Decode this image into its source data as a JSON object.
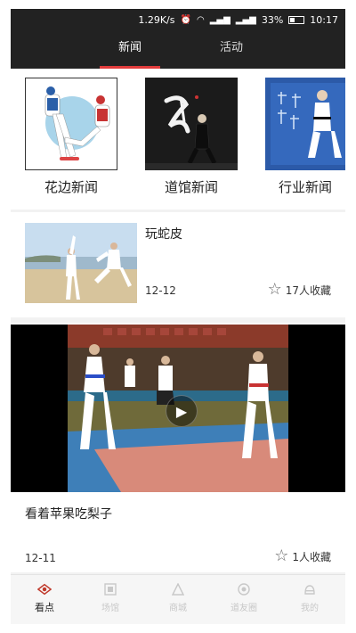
{
  "status_bar": {
    "speed": "1.29K/s",
    "battery": "33%",
    "time": "10:17"
  },
  "tabs": [
    {
      "label": "新闻",
      "active": true
    },
    {
      "label": "活动",
      "active": false
    }
  ],
  "categories": [
    {
      "label": "花边新闻"
    },
    {
      "label": "道馆新闻"
    },
    {
      "label": "行业新闻"
    }
  ],
  "articles": [
    {
      "title": "玩蛇皮",
      "date": "12-12",
      "favorites": "17人收藏",
      "star_icon": "star-outline-icon"
    },
    {
      "title": "看着苹果吃梨子",
      "date": "12-11",
      "favorites": "1人收藏",
      "star_icon": "star-outline-icon",
      "has_video": true
    }
  ],
  "bottom_nav": [
    {
      "label": "看点",
      "icon": "eye-icon",
      "active": true
    },
    {
      "label": "场馆",
      "icon": "venue-icon",
      "active": false
    },
    {
      "label": "商城",
      "icon": "mall-icon",
      "active": false
    },
    {
      "label": "道友圈",
      "icon": "circle-icon",
      "active": false
    },
    {
      "label": "我的",
      "icon": "profile-icon",
      "active": false
    }
  ],
  "colors": {
    "header_bg": "#222222",
    "accent": "#e23b3b",
    "page_bg": "#f2f2f2"
  }
}
